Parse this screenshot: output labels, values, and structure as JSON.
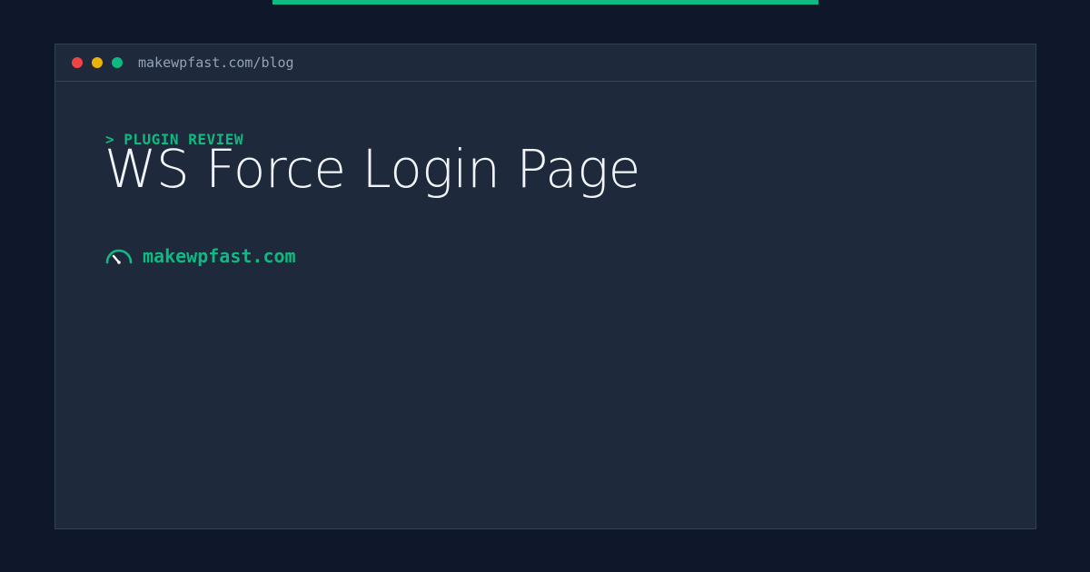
{
  "window": {
    "url": "makewpfast.com/blog",
    "controls": {
      "close_color": "#ef4444",
      "minimize_color": "#eab308",
      "maximize_color": "#10b981"
    }
  },
  "post": {
    "category": "> PLUGIN REVIEW",
    "title": "WS Force Login Page"
  },
  "brand": {
    "icon": "speedometer-icon",
    "name": "makewpfast.com"
  },
  "colors": {
    "background": "#0f172a",
    "panel": "#1e293b",
    "accent": "#10b981",
    "title_text": "#f1f5f9",
    "muted_text": "#94a3b8"
  }
}
